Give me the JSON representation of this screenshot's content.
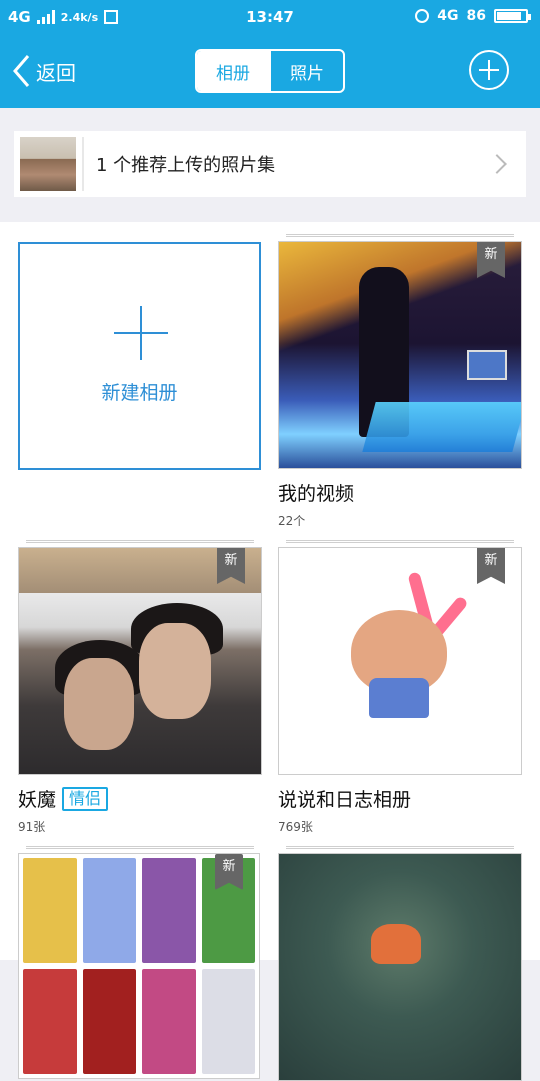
{
  "status_bar": {
    "network_left": "4G",
    "speed": "2.4k/s",
    "time": "13:47",
    "network_right": "4G",
    "battery_text": "86",
    "battery_level": 0.86
  },
  "navbar": {
    "back_label": "返回",
    "tabs": [
      {
        "label": "相册",
        "selected": true
      },
      {
        "label": "照片",
        "selected": false
      }
    ]
  },
  "recommend": {
    "text": "1 个推荐上传的照片集"
  },
  "new_album": {
    "label": "新建相册"
  },
  "albums": [
    {
      "title": "我的视频",
      "count": "22个",
      "badge": "新"
    },
    {
      "title": "妖魔",
      "tag": "情侣",
      "count": "91张",
      "badge": "新"
    },
    {
      "title": "说说和日志相册",
      "count": "769张",
      "badge": "新"
    },
    {
      "title": "",
      "count": "",
      "badge": "新"
    },
    {
      "title": "",
      "count": "",
      "badge": ""
    }
  ],
  "colors": {
    "accent": "#1aa8e2",
    "new_album_blue": "#2e8fd6",
    "badge_gray": "#666666"
  }
}
